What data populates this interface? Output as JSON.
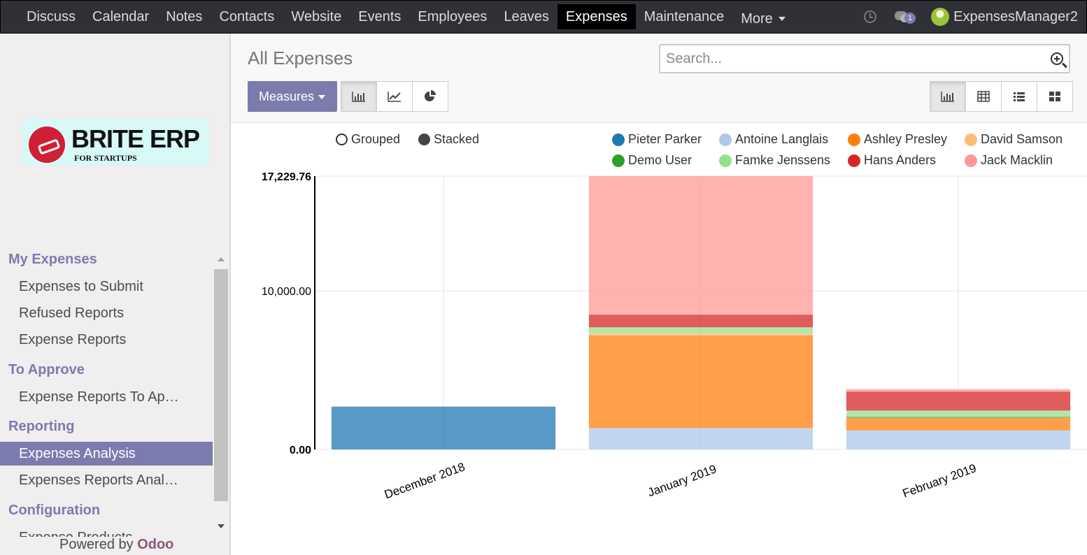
{
  "topbar": {
    "menu": [
      "Discuss",
      "Calendar",
      "Notes",
      "Contacts",
      "Website",
      "Events",
      "Employees",
      "Leaves",
      "Expenses",
      "Maintenance"
    ],
    "active": "Expenses",
    "more_label": "More",
    "message_count": "1",
    "username": "ExpensesManager2"
  },
  "logo": {
    "title": "BRITE ERP",
    "subtitle": "FOR STARTUPS"
  },
  "sidebar": {
    "sections": [
      {
        "title": "My Expenses",
        "items": [
          "Expenses to Submit",
          "Refused Reports",
          "Expense Reports"
        ]
      },
      {
        "title": "To Approve",
        "items": [
          "Expense Reports To Ap…"
        ]
      },
      {
        "title": "Reporting",
        "items": [
          "Expenses Analysis",
          "Expenses Reports Anal…"
        ]
      },
      {
        "title": "Configuration",
        "items": [
          "Expense Products"
        ]
      }
    ],
    "active_item": "Expenses Analysis",
    "powered_by": "Powered by",
    "powered_brand": "Odoo"
  },
  "control": {
    "breadcrumb": "All Expenses",
    "search_placeholder": "Search...",
    "measures_label": "Measures"
  },
  "chart_data": {
    "type": "bar",
    "stacked": true,
    "mode_options": [
      "Grouped",
      "Stacked"
    ],
    "selected_mode": "Stacked",
    "categories": [
      "December 2018",
      "January 2019",
      "February 2019"
    ],
    "y_ticks": [
      "0.00",
      "10,000.00",
      "17,229.76"
    ],
    "ylim": [
      0,
      17229.76
    ],
    "legend_placement": "top",
    "series": [
      {
        "name": "Pieter Parker",
        "color": "#1f77b4",
        "values": [
          2700,
          0,
          0
        ]
      },
      {
        "name": "Antoine Langlais",
        "color": "#aec7e8",
        "values": [
          0,
          1350,
          1200
        ]
      },
      {
        "name": "Ashley Presley",
        "color": "#ff7f0e",
        "values": [
          0,
          5850,
          800
        ]
      },
      {
        "name": "David Samson",
        "color": "#ffbb78",
        "values": [
          0,
          100,
          0
        ]
      },
      {
        "name": "Demo User",
        "color": "#2ca02c",
        "values": [
          0,
          0,
          50
        ]
      },
      {
        "name": "Famke Jenssens",
        "color": "#98df8a",
        "values": [
          0,
          400,
          400
        ]
      },
      {
        "name": "Hans Anders",
        "color": "#d62728",
        "values": [
          0,
          800,
          1200
        ]
      },
      {
        "name": "Jack Macklin",
        "color": "#ff9896",
        "values": [
          0,
          8730,
          150
        ]
      }
    ]
  }
}
